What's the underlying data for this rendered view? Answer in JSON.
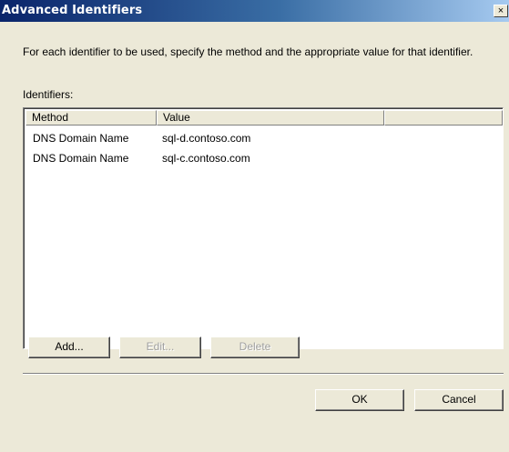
{
  "window": {
    "title": "Advanced Identifiers",
    "close_glyph": "×"
  },
  "description": "For each identifier to be used, specify the method and the appropriate value for that identifier.",
  "identifiers_label": "Identifiers:",
  "list": {
    "columns": [
      "Method",
      "Value"
    ],
    "rows": [
      {
        "method": "DNS Domain Name",
        "value": "sql-d.contoso.com"
      },
      {
        "method": "DNS Domain Name",
        "value": "sql-c.contoso.com"
      }
    ]
  },
  "buttons": {
    "add": "Add...",
    "edit": "Edit...",
    "delete": "Delete",
    "ok": "OK",
    "cancel": "Cancel"
  }
}
